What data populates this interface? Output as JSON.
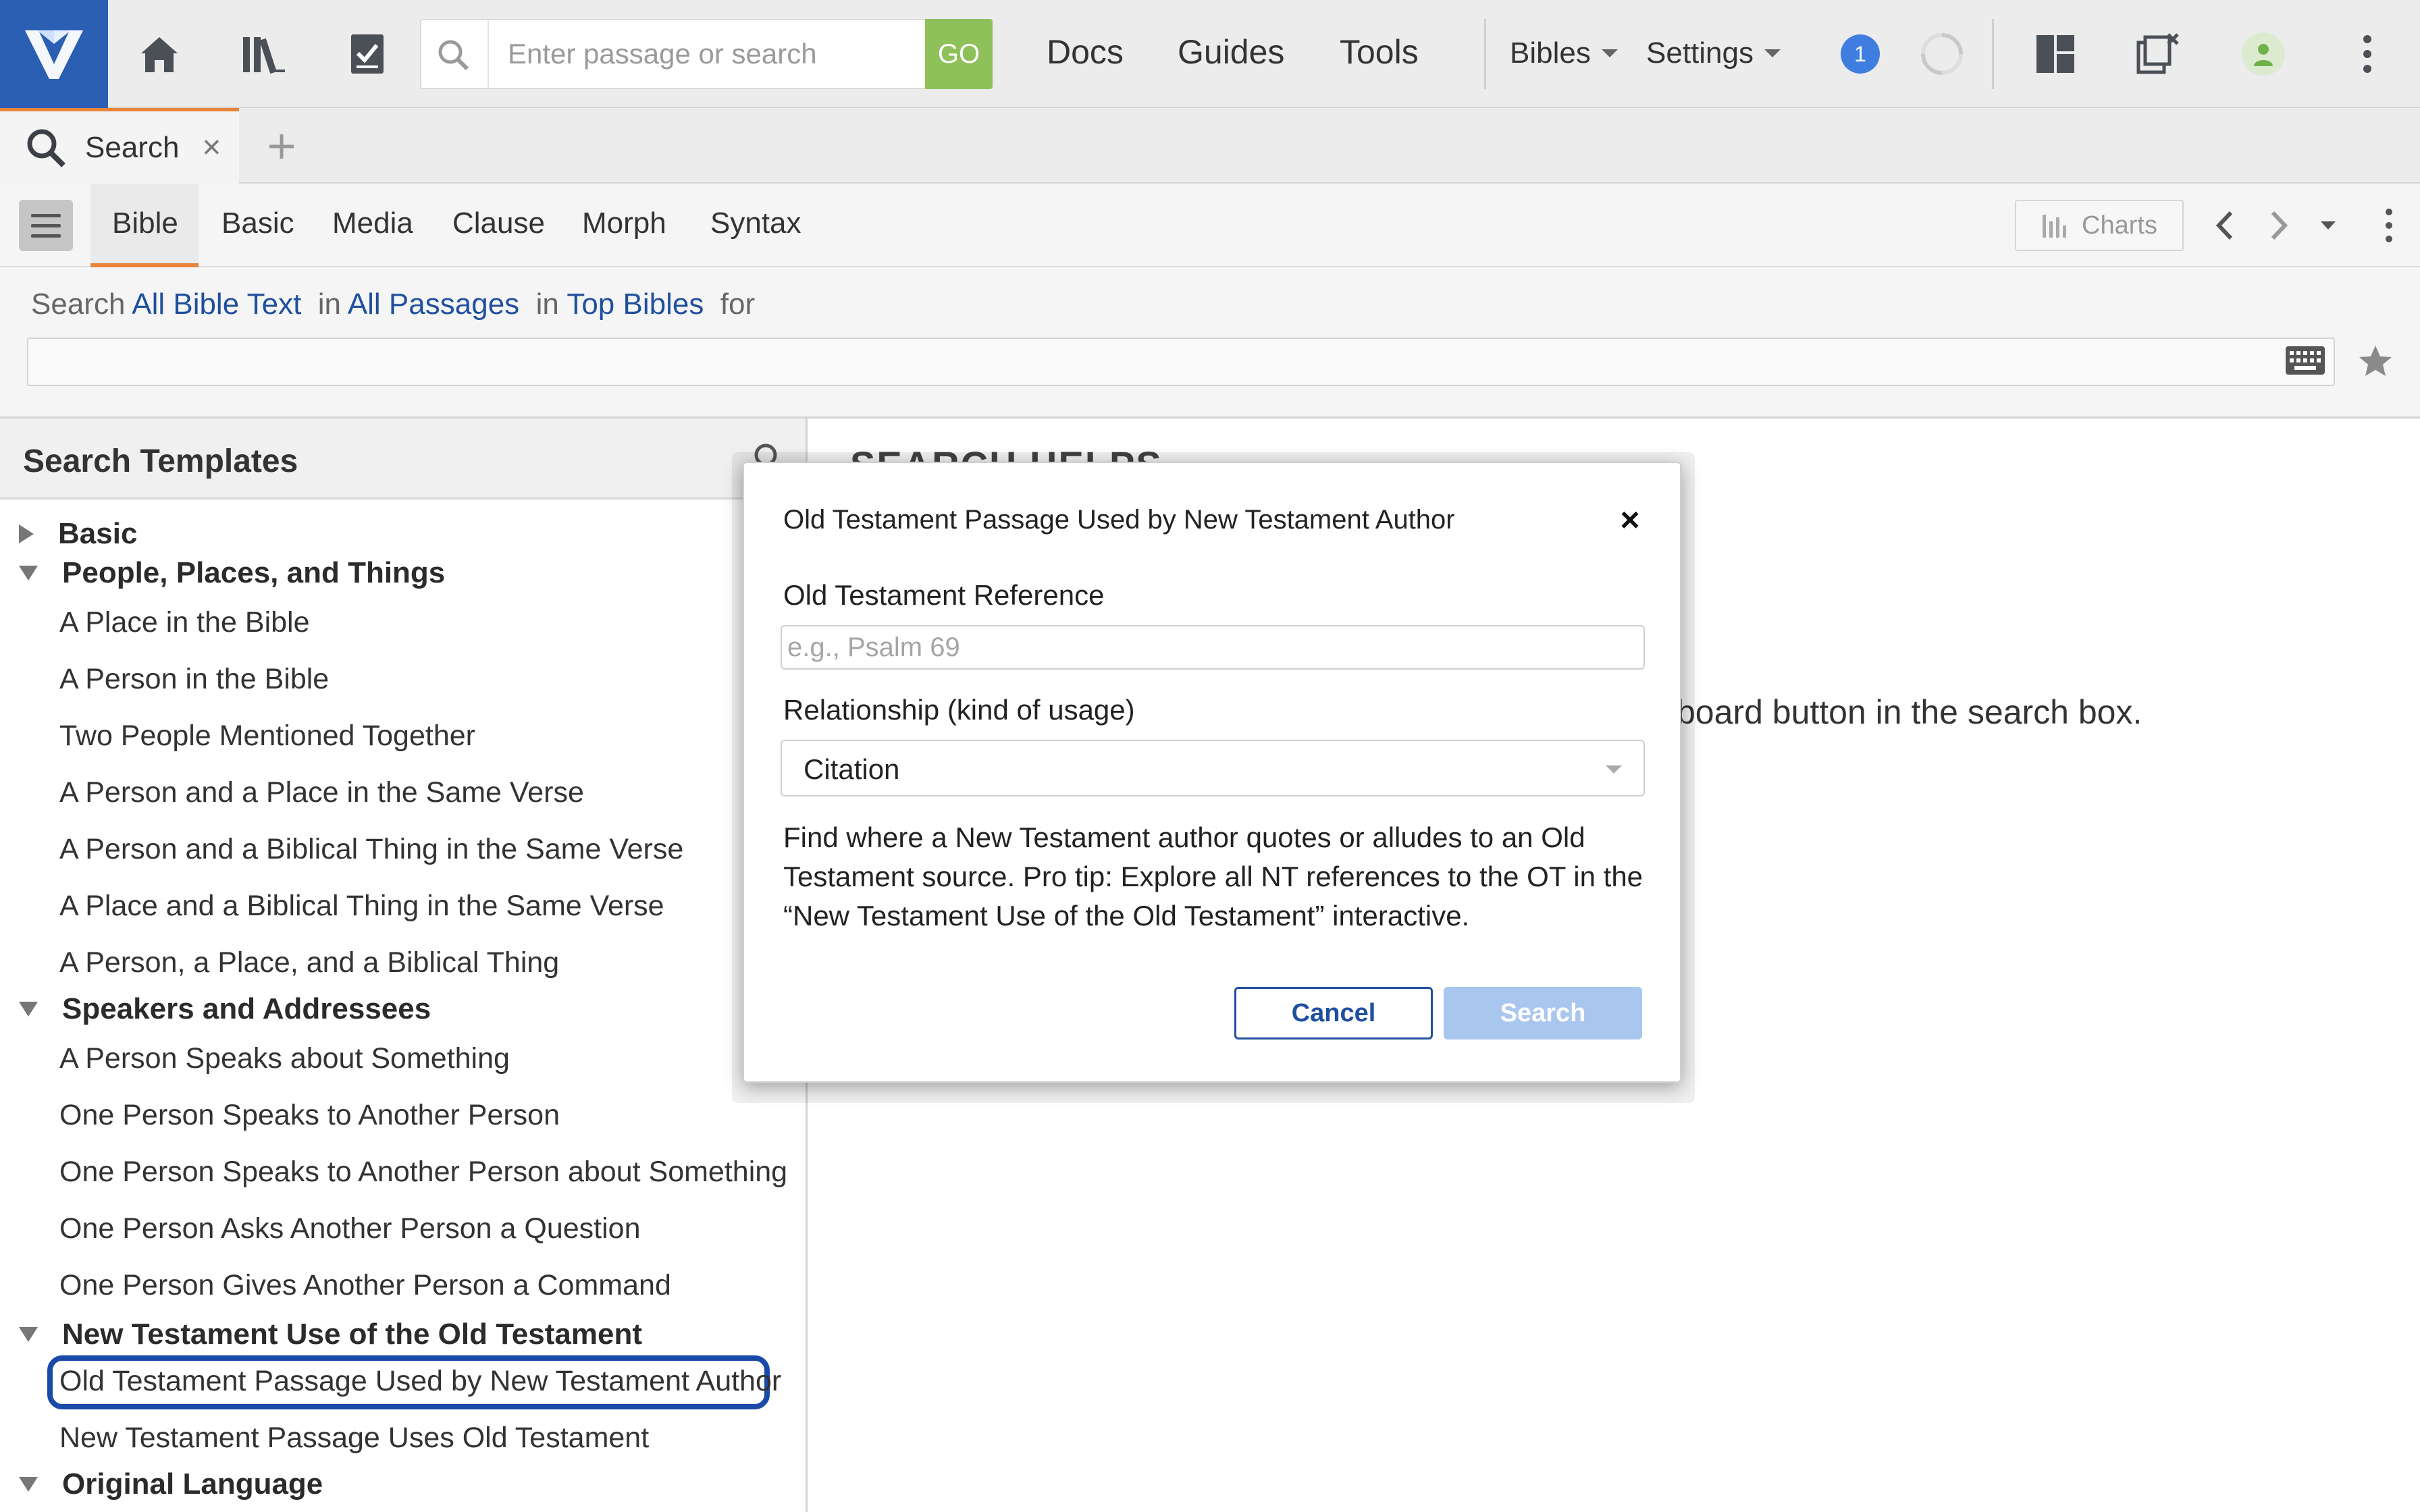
{
  "topbar": {
    "search_placeholder": "Enter passage or search",
    "go_label": "GO",
    "nav": [
      "Docs",
      "Guides",
      "Tools"
    ],
    "bibles_label": "Bibles",
    "settings_label": "Settings",
    "notification_count": "1",
    "icons": [
      "logo-icon",
      "home-icon",
      "library-icon",
      "checklist-icon",
      "search-icon",
      "sync-icon",
      "layout-icon",
      "close-panels-icon",
      "user-icon",
      "more-icon"
    ]
  },
  "tabs": {
    "active_label": "Search",
    "close_glyph": "×",
    "add_glyph": "+"
  },
  "subtoolbar": {
    "tabs": [
      "Bible",
      "Basic",
      "Media",
      "Clause",
      "Morph",
      "Syntax"
    ],
    "active_tab": "Bible",
    "charts_label": "Charts"
  },
  "search_row": {
    "prefix": "Search",
    "scope": "All Bible Text",
    "in1": "in",
    "passages": "All Passages",
    "in2": "in",
    "bibles": "Top Bibles",
    "suffix": "for",
    "query_value": ""
  },
  "left_panel": {
    "title": "Search Templates",
    "groups": [
      {
        "label": "Basic",
        "expanded": false,
        "items": []
      },
      {
        "label": "People, Places, and Things",
        "expanded": true,
        "items": [
          "A Place in the Bible",
          "A Person in the Bible",
          "Two People Mentioned Together",
          "A Person and a Place in the Same Verse",
          "A Person and a Biblical Thing in the Same Verse",
          "A Place and a Biblical Thing in the Same Verse",
          "A Person, a Place, and a Biblical Thing"
        ]
      },
      {
        "label": "Speakers and Addressees",
        "expanded": true,
        "items": [
          "A Person Speaks about Something",
          "One Person Speaks to Another Person",
          "One Person Speaks to Another Person about Something",
          "One Person Asks Another Person a Question",
          "One Person Gives Another Person a Command"
        ]
      },
      {
        "label": "New Testament Use of the Old Testament",
        "expanded": true,
        "items": [
          "Old Testament Passage Used by New Testament Author",
          "New Testament Passage Uses Old Testament"
        ]
      },
      {
        "label": "Original Language",
        "expanded": true,
        "items": []
      }
    ],
    "selected_item": "Old Testament Passage Used by New Testament Author"
  },
  "right_panel": {
    "heading": "SEARCH HELPS",
    "visible_text": "board button in the search box."
  },
  "modal": {
    "title": "Old Testament Passage Used by New Testament Author",
    "close_glyph": "×",
    "ot_label": "Old Testament Reference",
    "ot_placeholder": "e.g., Psalm 69",
    "ot_value": "",
    "rel_label": "Relationship (kind of usage)",
    "rel_value": "Citation",
    "description": "Find where a New Testament author quotes or alludes to an Old Testament source. Pro tip: Explore all NT references to the OT in the “New Testament Use of the Old Testament” interactive.",
    "cancel_label": "Cancel",
    "search_label": "Search"
  },
  "colors": {
    "brand": "#2b5fb4",
    "go": "#8fc15a",
    "accent_tab": "#e8843a",
    "link": "#1f4f9e",
    "selection_outline": "#1a4aa8",
    "search_button_disabled": "#a9c7ee"
  }
}
